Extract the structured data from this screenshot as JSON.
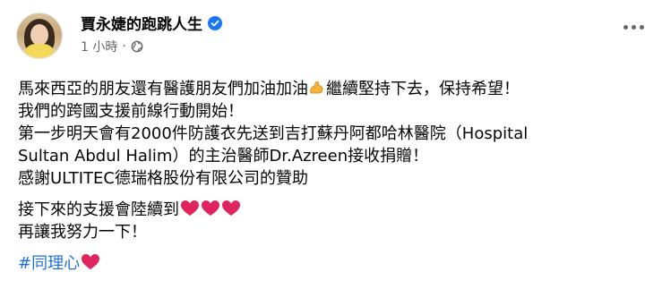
{
  "post": {
    "author": "賈永婕的跑跳人生",
    "timestamp": "1 小時",
    "separator": "·",
    "lines": [
      "馬來西亞的朋友還有醫護朋友們加油加油",
      "繼續堅持下去，保持希望！",
      "我們的跨國支援前線行動開始！",
      "第一步明天會有2000件防護衣先送到吉打蘇丹阿都哈林醫院（Hospital",
      "Sultan Abdul Halim）的主治醫師Dr.Azreen接收捐贈！",
      "感謝ULTITEC德瑞格股份有限公司的贊助",
      "接下來的支援會陸續到",
      "再讓我努力一下！"
    ],
    "hashtag": "#同理心"
  },
  "icons": {
    "verified": "verified-badge-icon",
    "privacy": "globe-icon",
    "more": "more-options-icon",
    "flex": "flexed-biceps-icon",
    "heart": "red-heart-icon"
  },
  "colors": {
    "verified": "#1877f2",
    "hashtag": "#216fdb",
    "heart": "#e0245e",
    "meta": "#65676b"
  }
}
